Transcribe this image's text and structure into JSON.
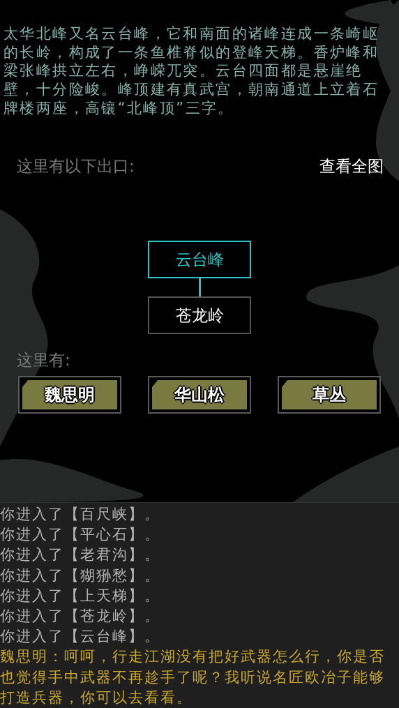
{
  "description": "太华北峰又名云台峰，它和南面的诸峰连成一条崎岖的长岭，构成了一条鱼椎脊似的登峰天梯。香炉峰和梁张峰拱立左右，峥嵘兀突。云台四面都是悬崖绝壁，十分险峻。峰顶建有真武宫，朝南通道上立着石牌楼两座，高镶“北峰顶”三字。",
  "exits": {
    "label": "这里有以下出口:",
    "map_button": "查看全图",
    "nodes": [
      {
        "name": "云台峰",
        "selected": true
      },
      {
        "name": "苍龙岭",
        "selected": false
      }
    ]
  },
  "present": {
    "label": "这里有:",
    "items": [
      "魏思明",
      "华山松",
      "草丛"
    ]
  },
  "log": [
    {
      "kind": "system",
      "text": "你进入了【百尺峡】。"
    },
    {
      "kind": "system",
      "text": "你进入了【平心石】。"
    },
    {
      "kind": "system",
      "text": "你进入了【老君沟】。"
    },
    {
      "kind": "system",
      "text": "你进入了【猢狲愁】。"
    },
    {
      "kind": "system",
      "text": "你进入了【上天梯】。"
    },
    {
      "kind": "system",
      "text": "你进入了【苍龙岭】。"
    },
    {
      "kind": "system",
      "text": "你进入了【云台峰】。"
    },
    {
      "kind": "dialogue",
      "text": "魏思明：呵呵，行走江湖没有把好武器怎么行，你是否也觉得手中武器不再趁手了呢？我听说名匠欧冶子能够打造兵器，你可以去看看。"
    }
  ]
}
